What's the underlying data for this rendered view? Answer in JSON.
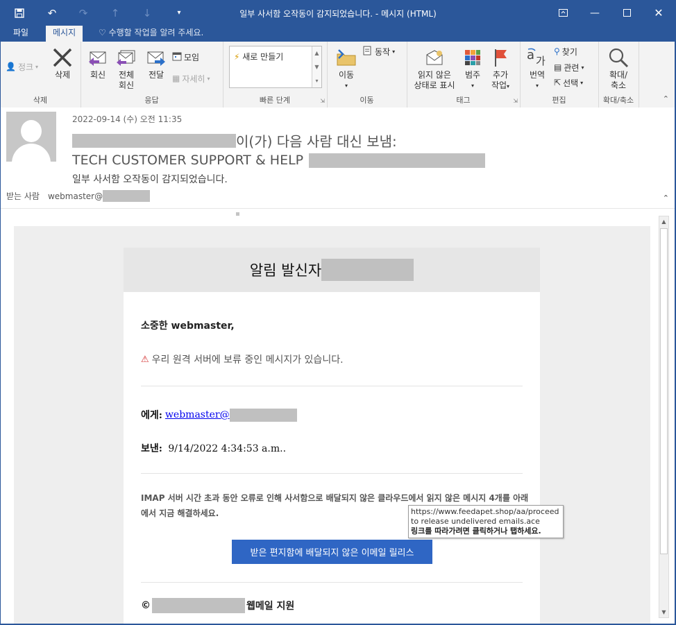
{
  "window": {
    "title": "일부 사서함 오작동이 감지되었습니다. - 메시지 (HTML)"
  },
  "tabs": [
    {
      "label": "파일"
    },
    {
      "label": "메시지"
    }
  ],
  "tellme": "수행할 작업을 알려 주세요.",
  "ribbon": {
    "delete_group": {
      "label": "삭제",
      "junk": "정크",
      "delete": "삭제"
    },
    "respond_group": {
      "label": "응답",
      "reply": "회신",
      "reply_all_1": "전체",
      "reply_all_2": "회신",
      "forward": "전달",
      "meeting": "모임",
      "more": "자세히"
    },
    "quicksteps_group": {
      "label": "빠른 단계",
      "create_new": "새로 만들기"
    },
    "move_group": {
      "label": "이동",
      "move": "이동",
      "actions": "동작"
    },
    "tags_group": {
      "label": "태그",
      "mark_unread_1": "읽지 않은",
      "mark_unread_2": "상태로 표시",
      "categorize": "범주",
      "followup_1": "추가",
      "followup_2": "작업"
    },
    "edit_group": {
      "label": "편집",
      "translate": "번역",
      "find": "찾기",
      "related": "관련",
      "select": "선택"
    },
    "zoom_group": {
      "label": "확대/축소",
      "zoom_1": "확대/",
      "zoom_2": "축소"
    }
  },
  "header": {
    "date": "2022-09-14 (수) 오전 11:35",
    "on_behalf_suffix": "이(가) 다음 사람 대신 보냄:",
    "sender_name": "TECH CUSTOMER SUPPORT & HELP",
    "subject": "일부 사서함 오작동이 감지되었습니다.",
    "to_label": "받는 사람",
    "to_value": "webmaster@"
  },
  "email": {
    "title_prefix": "알림 발신자",
    "greeting": "소중한 webmaster,",
    "warning": "우리 원격 서버에 보류 중인 메시지가 있습니다.",
    "to_label": "에게:",
    "to_value": "webmaster@",
    "from_label": "보낸:",
    "from_value": "9/14/2022 4:34:53 a.m..",
    "description": "IMAP 서버 시간 초과 동안 오류로 인해 사서함으로 배달되지 않은 클라우드에서 읽지 않은 메시지 4개를 아래에서 지금 해결하세요.",
    "button": "받은 편지함에 배달되지 않은 이메일 릴리스",
    "footer_prefix": "©",
    "footer_suffix": "웹메일 지원"
  },
  "tooltip": {
    "line1": "https://www.feedapet.shop/aa/proceed",
    "line2": "to release undelivered emails.ace",
    "line3": "링크를 따라가려면 클릭하거나 탭하세요."
  }
}
